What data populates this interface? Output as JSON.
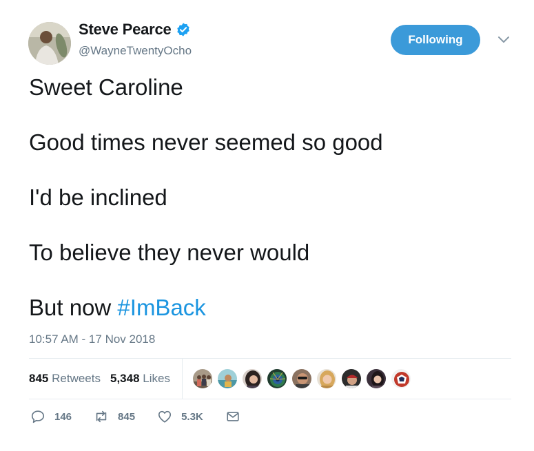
{
  "author": {
    "name": "Steve Pearce",
    "handle": "@WayneTwentyOcho",
    "verified": true
  },
  "follow_button": {
    "label": "Following",
    "color": "#3b9ad9"
  },
  "tweet": {
    "lines": [
      "Sweet Caroline",
      "Good times never seemed so good",
      "I'd be inclined",
      "To believe they never would"
    ],
    "last_line_prefix": "But now ",
    "hashtag": "#ImBack",
    "timestamp": "10:57 AM - 17 Nov 2018"
  },
  "stats": {
    "retweets_count": "845",
    "retweets_label": "Retweets",
    "likes_count": "5,348",
    "likes_label": "Likes"
  },
  "liker_avatars": [
    {
      "icon": "avatar-group-photo",
      "color": "#8a7d6e"
    },
    {
      "icon": "avatar-beach",
      "color": "#5fa3b0"
    },
    {
      "icon": "avatar-woman-dark-hair",
      "color": "#4a3d3a"
    },
    {
      "icon": "avatar-peacock",
      "color": "#2f6b4a"
    },
    {
      "icon": "avatar-man-sunglasses",
      "color": "#6b5446"
    },
    {
      "icon": "avatar-woman-blonde",
      "color": "#c9a36e"
    },
    {
      "icon": "avatar-man-cap",
      "color": "#7a2a2a"
    },
    {
      "icon": "avatar-woman-portrait",
      "color": "#3a2f3a"
    },
    {
      "icon": "avatar-team-logo",
      "color": "#c0392b"
    }
  ],
  "actions": {
    "reply_count": "146",
    "retweet_count": "845",
    "like_count": "5.3K"
  },
  "colors": {
    "accent": "#1b95e0",
    "muted": "#657786",
    "text": "#14171a",
    "divider": "#e6ecf0"
  }
}
